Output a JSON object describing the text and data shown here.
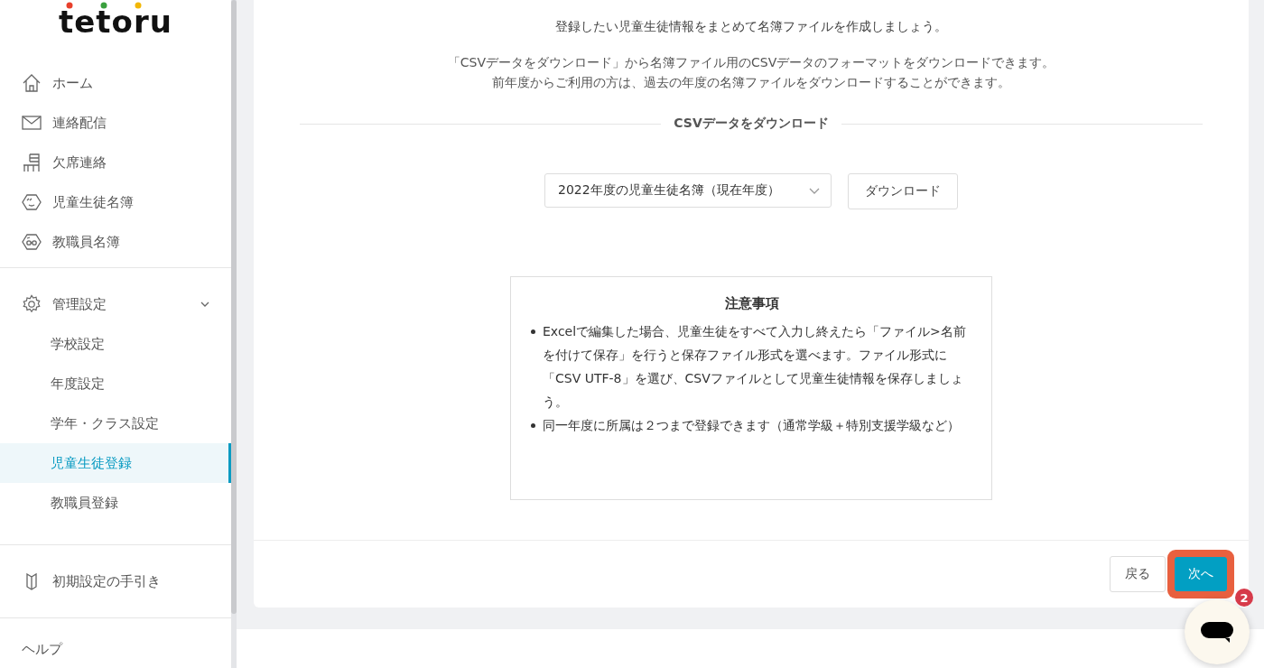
{
  "logo": "tetoru",
  "sidebar": {
    "nav": [
      {
        "label": "ホーム"
      },
      {
        "label": "連絡配信"
      },
      {
        "label": "欠席連絡"
      },
      {
        "label": "児童生徒名簿"
      },
      {
        "label": "教職員名簿"
      }
    ],
    "settings": {
      "label": "管理設定",
      "expanded": true,
      "items": [
        {
          "label": "学校設定",
          "selected": false
        },
        {
          "label": "年度設定",
          "selected": false
        },
        {
          "label": "学年・クラス設定",
          "selected": false
        },
        {
          "label": "児童生徒登録",
          "selected": true
        },
        {
          "label": "教職員登録",
          "selected": false
        }
      ]
    },
    "guide": {
      "label": "初期設定の手引き"
    },
    "help": {
      "label": "ヘルプ"
    }
  },
  "main": {
    "intro": "登録したい児童生徒情報をまとめて名簿ファイルを作成しましょう。",
    "description": [
      "「CSVデータをダウンロード」から名簿ファイル用のCSVデータのフォーマットをダウンロードできます。",
      "前年度からご利用の方は、過去の年度の名簿ファイルをダウンロードすることができます。"
    ],
    "section_title": "CSVデータをダウンロード",
    "year_select": {
      "value": "2022年度の児童生徒名簿（現在年度）"
    },
    "download_button": "ダウンロード",
    "notes": {
      "title": "注意事項",
      "items": [
        "Excelで編集した場合、児童生徒をすべて入力し終えたら「ファイル>名前を付けて保存」を行うと保存ファイル形式を選べます。ファイル形式に「CSV UTF-8」を選び、CSVファイルとして児童生徒情報を保存しましょう。",
        "同一年度に所属は２つまで登録できます（通常学級＋特別支援学級など）"
      ]
    },
    "buttons": [
      {
        "label": "戻る",
        "kind": "secondary",
        "highlighted": false
      },
      {
        "label": "次へ",
        "kind": "primary",
        "highlighted": true
      }
    ]
  },
  "chat": {
    "badge": "2"
  }
}
